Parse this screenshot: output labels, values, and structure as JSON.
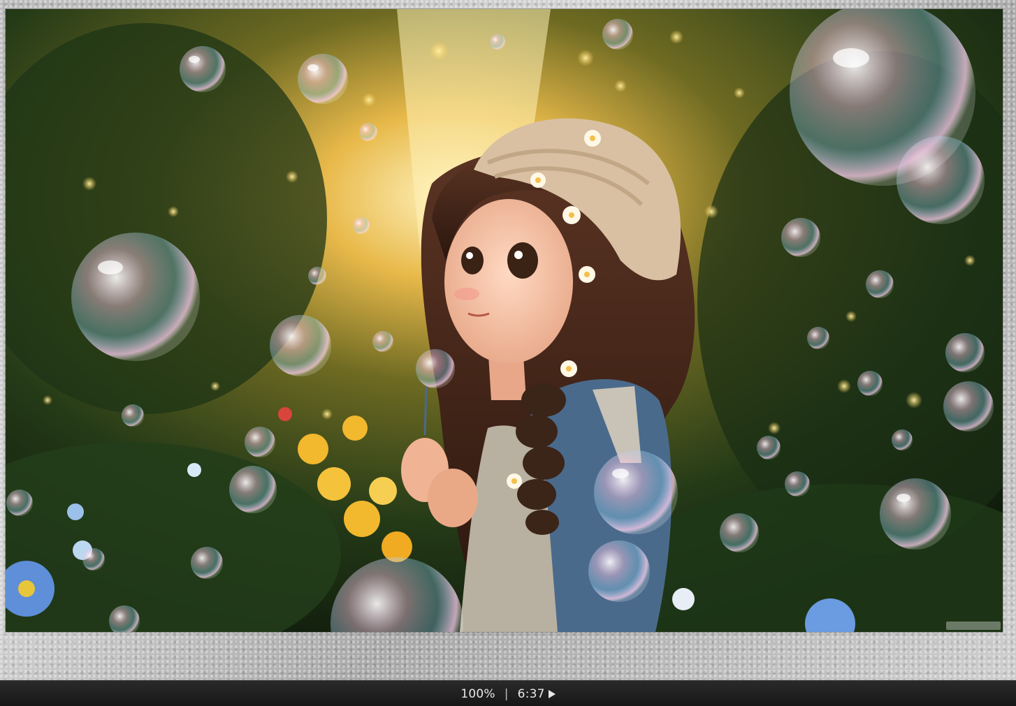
{
  "status": {
    "zoom": "100%",
    "separator": "|",
    "timer": "6:37",
    "play_icon": "play-icon"
  },
  "image": {
    "description_icon": "photo-image",
    "colors": {
      "background_dark": "#1c2a14",
      "glow": "#ffd77a",
      "hat": "#d9c0a2",
      "hair": "#3b2418",
      "jacket": "#4a6a8c",
      "flowers_yellow": "#f2b82e",
      "flowers_blue": "#6b9be0"
    }
  }
}
